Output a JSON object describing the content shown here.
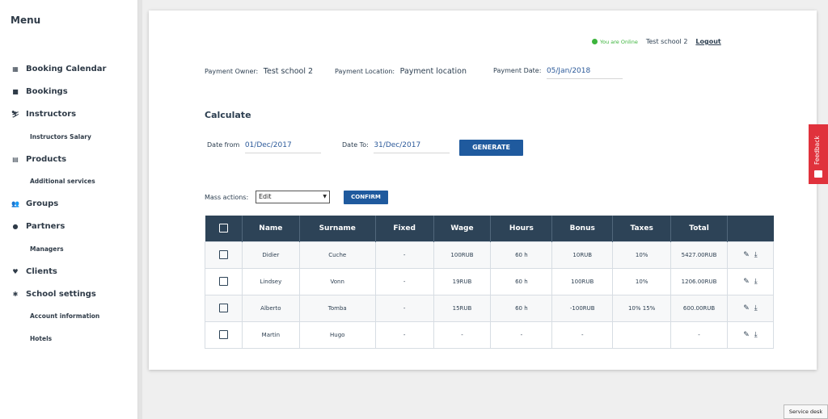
{
  "sidebar": {
    "title": "Menu",
    "items": [
      {
        "label": "Booking Calendar",
        "icon": "calendar-icon"
      },
      {
        "label": "Bookings",
        "icon": "book-icon"
      },
      {
        "label": "Instructors",
        "icon": "skier-icon"
      },
      {
        "label": "Instructors Salary",
        "sub": true
      },
      {
        "label": "Products",
        "icon": "list-icon"
      },
      {
        "label": "Additional services",
        "sub": true
      },
      {
        "label": "Groups",
        "icon": "users-icon"
      },
      {
        "label": "Partners",
        "icon": "user-icon"
      },
      {
        "label": "Managers",
        "sub": true
      },
      {
        "label": "Clients",
        "icon": "heart-icon"
      },
      {
        "label": "School settings",
        "icon": "gear-icon"
      },
      {
        "label": "Account information",
        "sub": true
      },
      {
        "label": "Hotels",
        "sub": true
      }
    ]
  },
  "header": {
    "online_text": "You are Online",
    "school": "Test school 2",
    "logout": "Logout"
  },
  "payment": {
    "owner_label": "Payment Owner:",
    "owner_value": "Test school 2",
    "location_label": "Payment Location:",
    "location_value": "Payment location",
    "date_label": "Payment Date:",
    "date_value": "05/Jan/2018"
  },
  "calculate": {
    "title": "Calculate",
    "date_from_label": "Date from",
    "date_from_value": "01/Dec/2017",
    "date_to_label": "Date To:",
    "date_to_value": "31/Dec/2017",
    "generate_label": "GENERATE"
  },
  "mass_actions": {
    "label": "Mass actions:",
    "selected": "Edit",
    "confirm_label": "CONFIRM"
  },
  "table": {
    "columns": [
      "Name",
      "Surname",
      "Fixed",
      "Wage",
      "Hours",
      "Bonus",
      "Taxes",
      "Total"
    ],
    "rows": [
      [
        "Didier",
        "Cuche",
        "-",
        "100RUB",
        "60 h",
        "10RUB",
        "10%",
        "5427.00RUB"
      ],
      [
        "Lindsey",
        "Vonn",
        "-",
        "19RUB",
        "60 h",
        "100RUB",
        "10%",
        "1206.00RUB"
      ],
      [
        "Alberto",
        "Tomba",
        "-",
        "15RUB",
        "60 h",
        "-100RUB",
        "10% 15%",
        "600.00RUB"
      ],
      [
        "Martin",
        "Hugo",
        "-",
        "-",
        "-",
        "-",
        "",
        "-"
      ]
    ]
  },
  "feedback": {
    "label": "Feedback"
  },
  "service_desk": {
    "label": "Service desk"
  },
  "colors": {
    "primary_button": "#1f5a9e",
    "table_header": "#2d4357",
    "online": "#3cb43c",
    "feedback": "#e0323c"
  }
}
